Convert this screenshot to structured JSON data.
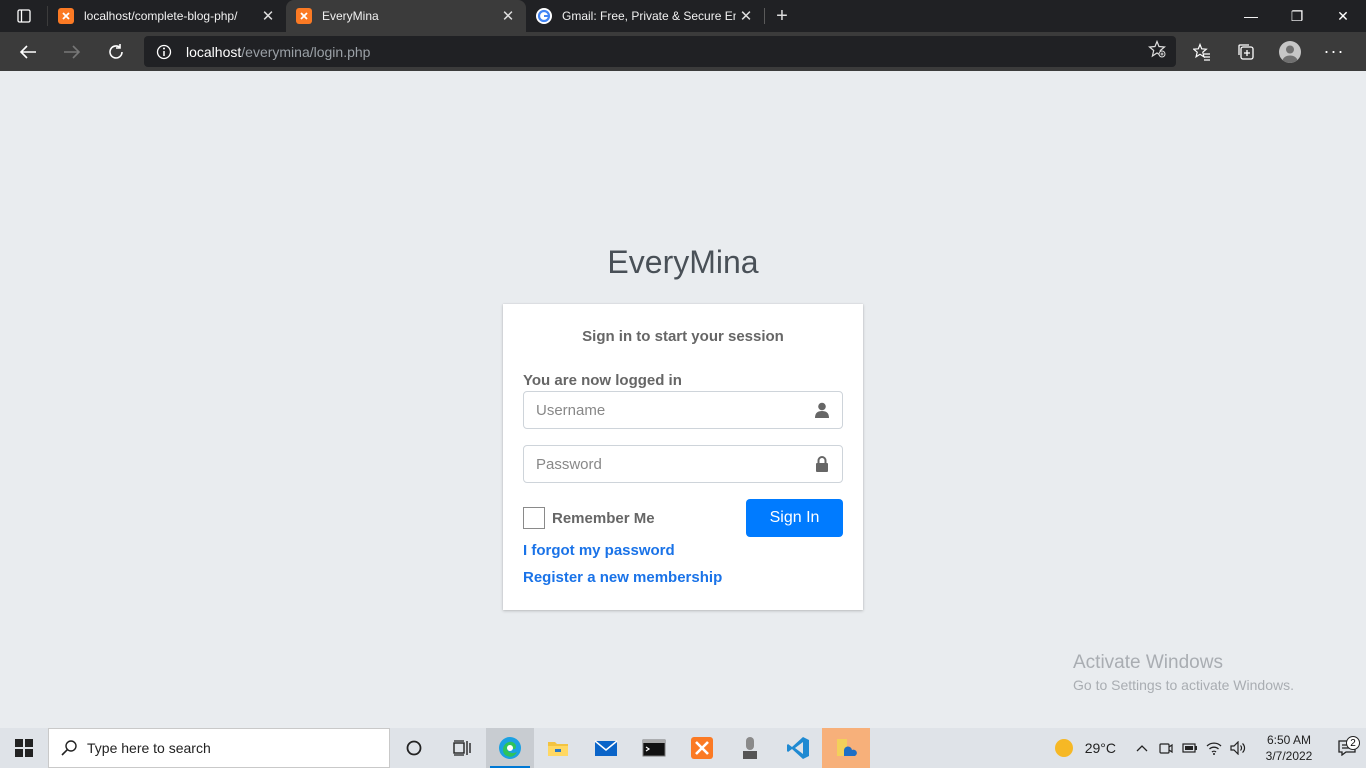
{
  "browser": {
    "tabs": [
      {
        "title": "localhost/complete-blog-php/",
        "favicon": "xampp-icon"
      },
      {
        "title": "EveryMina",
        "favicon": "xampp-icon",
        "active": true
      },
      {
        "title": "Gmail: Free, Private & Secure Em",
        "favicon": "google-icon"
      }
    ],
    "address": {
      "host": "localhost",
      "path": "/everymina/login.php"
    }
  },
  "page": {
    "logo": "EveryMina",
    "login_message": "Sign in to start your session",
    "status": "You are now logged in",
    "username_placeholder": "Username",
    "password_placeholder": "Password",
    "remember_label": "Remember Me",
    "signin_label": "Sign In",
    "forgot_link": "I forgot my password",
    "register_link": "Register a new membership"
  },
  "watermark": {
    "line1": "Activate Windows",
    "line2": "Go to Settings to activate Windows."
  },
  "taskbar": {
    "search_placeholder": "Type here to search",
    "weather": "29°C",
    "time": "6:50 AM",
    "date": "3/7/2022",
    "notification_count": "2"
  },
  "colors": {
    "primary": "#007bff",
    "link": "#1a73e8",
    "page_bg": "#e9ecef"
  }
}
